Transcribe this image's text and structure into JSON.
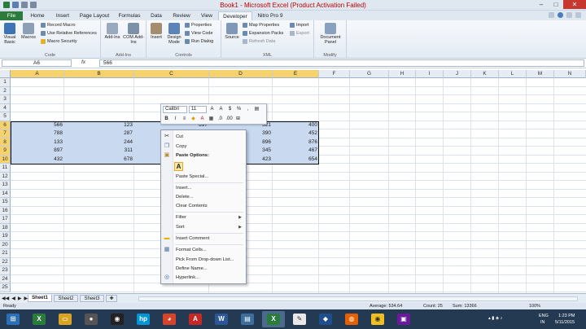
{
  "window": {
    "title": "Book1 - Microsoft Excel (Product Activation Failed)"
  },
  "tabs": [
    "File",
    "Home",
    "Insert",
    "Page Layout",
    "Formulas",
    "Data",
    "Review",
    "View",
    "Developer",
    "Nitro Pro 9"
  ],
  "active_tab": "Developer",
  "ribbon": {
    "code": {
      "label": "Code",
      "visual_basic": "Visual Basic",
      "macros": "Macros",
      "record_macro": "Record Macro",
      "relative_refs": "Use Relative References",
      "macro_security": "Macro Security"
    },
    "addins": {
      "label": "Add-Ins",
      "addins_btn": "Add-Ins",
      "com_addins": "COM Add-Ins"
    },
    "controls": {
      "label": "Controls",
      "insert": "Insert",
      "design_mode": "Design Mode",
      "properties": "Properties",
      "view_code": "View Code",
      "run_dialog": "Run Dialog"
    },
    "xml": {
      "label": "XML",
      "source": "Source",
      "map_properties": "Map Properties",
      "expansion_packs": "Expansion Packs",
      "refresh_data": "Refresh Data",
      "import": "Import",
      "export": "Export"
    },
    "modify": {
      "label": "Modify",
      "document_panel": "Document Panel"
    }
  },
  "formula_bar": {
    "name_box": "A6",
    "fx": "fx",
    "value": "566"
  },
  "columns": [
    "A",
    "B",
    "C",
    "D",
    "E",
    "F",
    "G",
    "H",
    "I",
    "J",
    "K",
    "L",
    "M",
    "N"
  ],
  "rows": [
    "1",
    "2",
    "3",
    "4",
    "5",
    "6",
    "7",
    "8",
    "9",
    "10",
    "11",
    "12",
    "13",
    "14",
    "15",
    "16",
    "17",
    "18",
    "19",
    "20",
    "21",
    "22",
    "23",
    "24",
    "25",
    "26",
    "27",
    "28",
    "29",
    "30"
  ],
  "cells": {
    "A": [
      "566",
      "788",
      "133",
      "897",
      "432"
    ],
    "B": [
      "123",
      "287",
      "244",
      "311",
      "678"
    ],
    "C": [
      "897",
      "",
      "",
      "",
      ""
    ],
    "D": [
      "321",
      "390",
      "896",
      "345",
      "423"
    ],
    "E": [
      "400",
      "452",
      "876",
      "467",
      "654"
    ]
  },
  "mini_toolbar": {
    "font": "Calibri",
    "size": "11"
  },
  "context_menu": {
    "cut": "Cut",
    "copy": "Copy",
    "paste_options": "Paste Options:",
    "paste_special": "Paste Special...",
    "insert": "Insert...",
    "delete": "Delete...",
    "clear_contents": "Clear Contents",
    "filter": "Filter",
    "sort": "Sort",
    "insert_comment": "Insert Comment",
    "format_cells": "Format Cells...",
    "pick_from_list": "Pick From Drop-down List...",
    "define_name": "Define Name...",
    "hyperlink": "Hyperlink..."
  },
  "sheets": [
    "Sheet1",
    "Sheet2",
    "Sheet3"
  ],
  "status": {
    "left": "Ready",
    "average": "Average: 534.64",
    "count": "Count: 25",
    "sum": "Sum: 13366",
    "zoom": "100%"
  },
  "tray": {
    "lang": "ENG",
    "region": "IN",
    "time": "1:23 PM",
    "date": "5/11/2015"
  },
  "colors": {
    "excel_green": "#2a7b3c",
    "selection": "#c9d9ef",
    "header_selected": "#f6d26d"
  }
}
